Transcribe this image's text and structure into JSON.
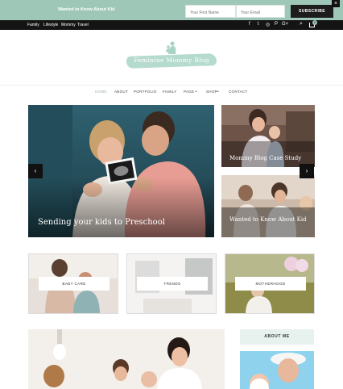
{
  "promo": {
    "text": "Wanted to Know About Kid",
    "first_name_placeholder": "Your First Name",
    "email_placeholder": "Your Email",
    "subscribe_label": "SUBSCRIBE",
    "close_label": "×"
  },
  "topbar": {
    "categories": [
      "Family",
      "Lifestyle",
      "Mommy",
      "Travel"
    ],
    "social_icons": [
      "facebook-icon",
      "twitter-icon",
      "instagram-icon",
      "pinterest-icon",
      "google-plus-icon"
    ],
    "social_glyphs": [
      "f",
      "t",
      "◎",
      "P",
      "G+"
    ],
    "search_glyph": "⌕",
    "cart_count": "0"
  },
  "logo": {
    "text": "Feminine Mommy Blog",
    "accent": "#a8d4c6"
  },
  "nav": {
    "items": [
      "HOME",
      "ABOUT",
      "PORTFOLIO",
      "FAMILY",
      "PAGE",
      "SHOP",
      "CONTACT"
    ],
    "dropdown_glyph": "⌄"
  },
  "hero": {
    "main_title": "Sending your kids to Preschool",
    "side_one_title": "Mommy Blog Case Study",
    "side_two_title": "Wanted to Know About Kid",
    "prev_glyph": "‹",
    "next_glyph": "›"
  },
  "categories": [
    "BABY CARE",
    "TRENDS",
    "MOTHERHOOD"
  ],
  "sidebar": {
    "about_title": "ABOUT ME"
  },
  "colors": {
    "mint": "#9fc7b8",
    "dark": "#141414"
  }
}
